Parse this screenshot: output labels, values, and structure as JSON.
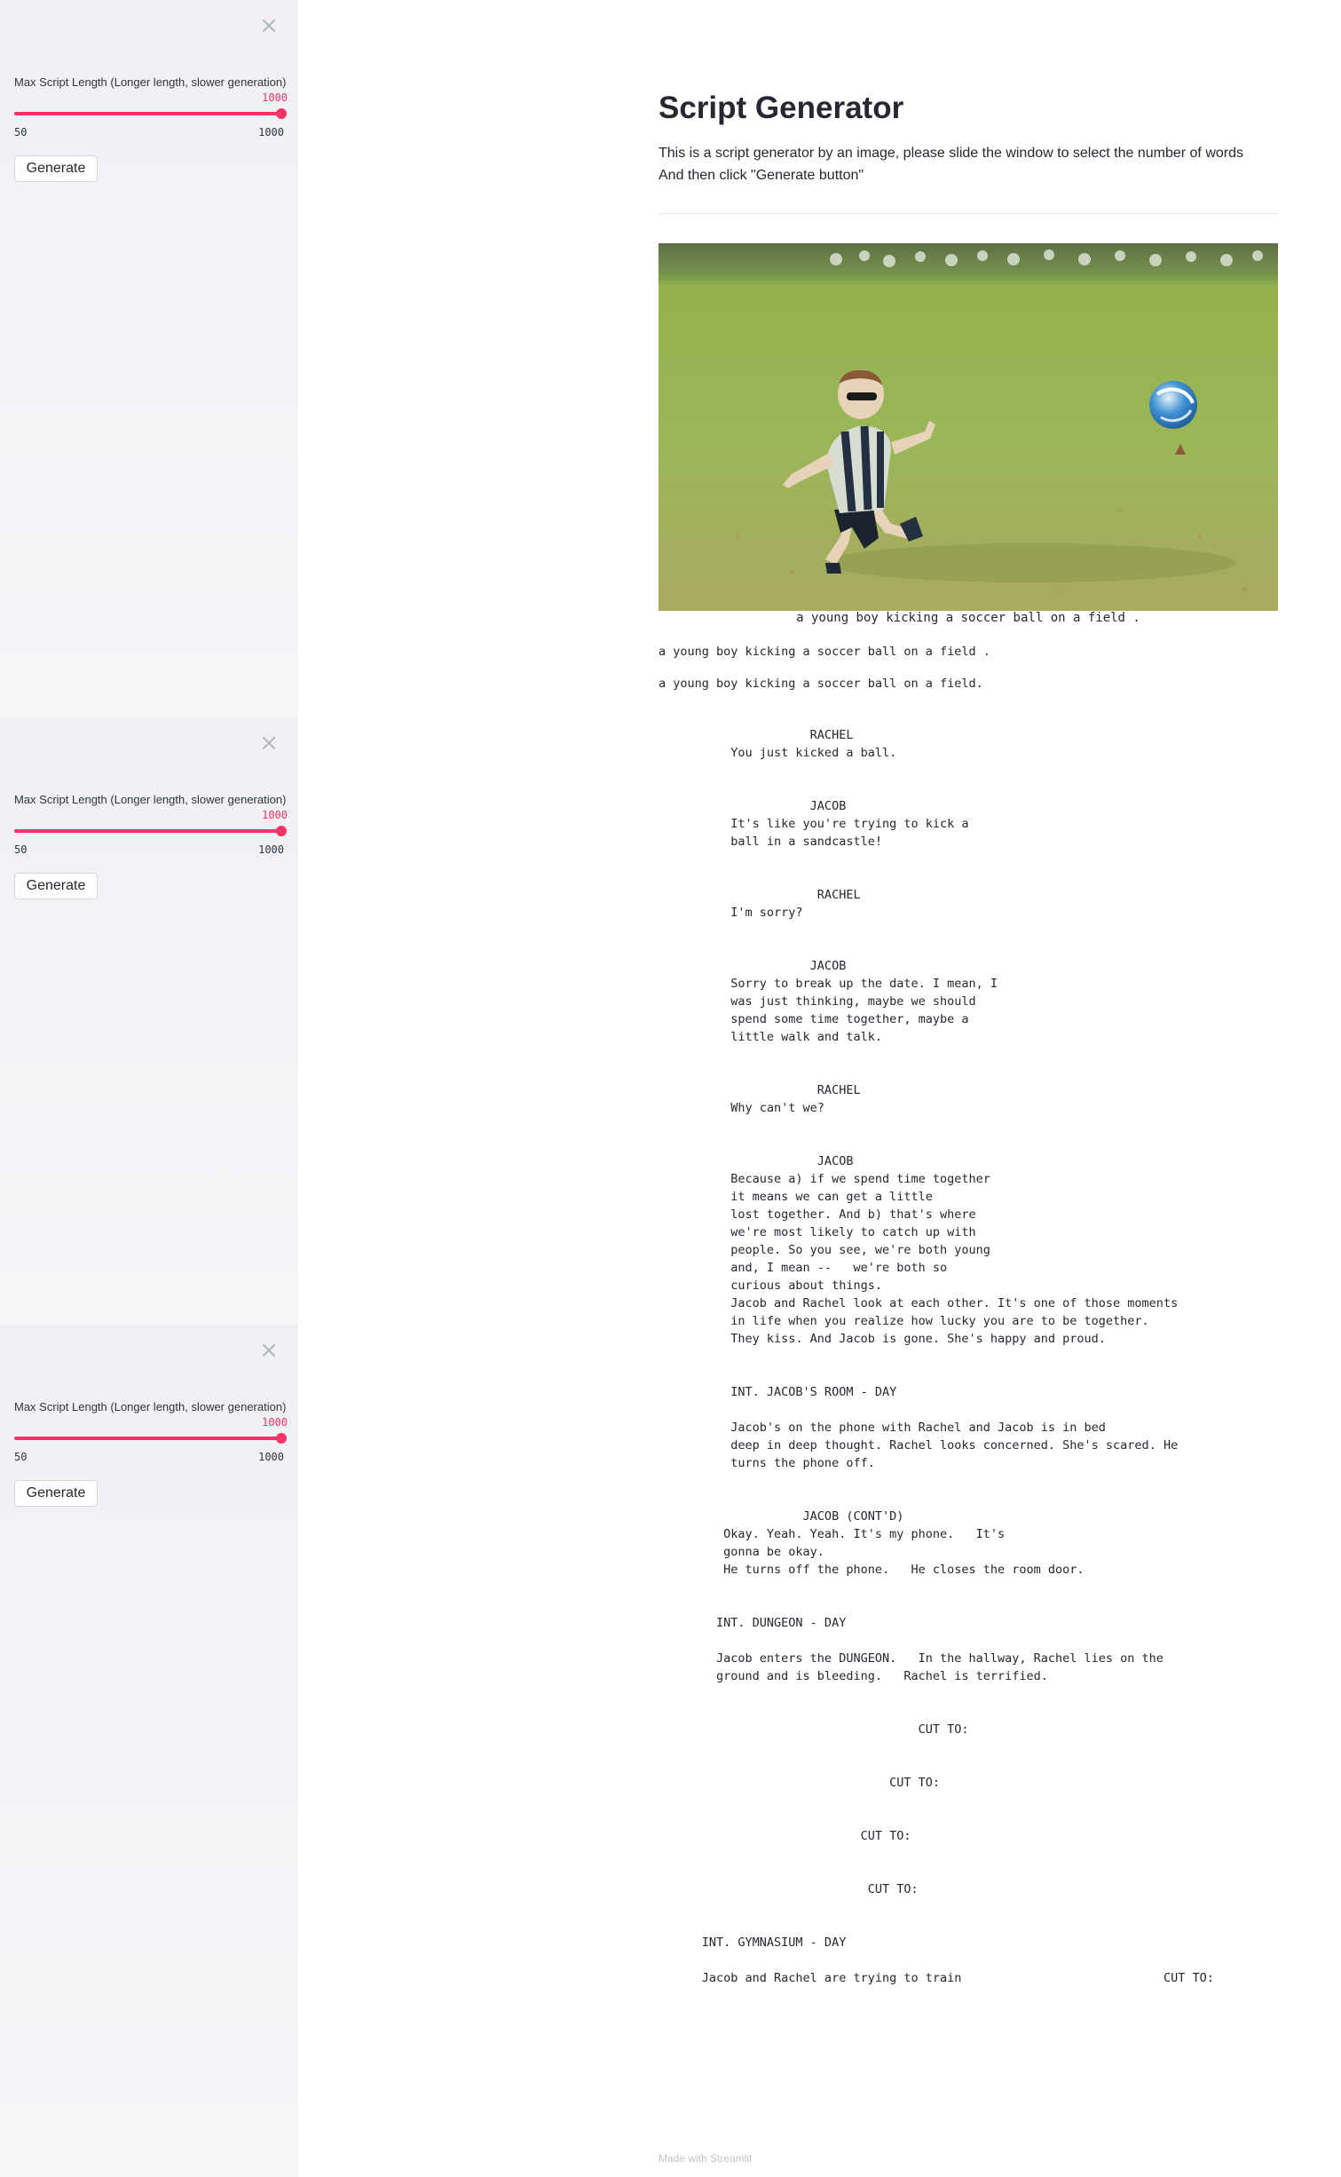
{
  "sidebar_panels": [
    {
      "close_icon": "close-icon",
      "slider_label": "Max Script Length (Longer length, slower generation)",
      "slider_value": "1000",
      "slider_min": "50",
      "slider_max": "1000",
      "slider_level": 1.0,
      "generate_label": "Generate"
    },
    {
      "close_icon": "close-icon",
      "slider_label": "Max Script Length (Longer length, slower generation)",
      "slider_value": "1000",
      "slider_min": "50",
      "slider_max": "1000",
      "slider_level": 1.0,
      "generate_label": "Generate"
    },
    {
      "close_icon": "close-icon",
      "slider_label": "Max Script Length (Longer length, slower generation)",
      "slider_value": "1000",
      "slider_min": "50",
      "slider_max": "1000",
      "slider_level": 1.0,
      "generate_label": "Generate"
    }
  ],
  "main": {
    "title": "Script Generator",
    "description_line1": "This is a script generator by an image, please slide the window to select the number of words",
    "description_line2": "And then click \"Generate button\"",
    "image_caption": "a young boy kicking a soccer ball on a field .",
    "caption_line1": "a young boy kicking a soccer ball on a field .",
    "caption_line2": "a young boy kicking a soccer ball on a field.",
    "script_text": "                     RACHEL\n          You just kicked a ball.\n\n\n                     JACOB\n          It's like you're trying to kick a\n          ball in a sandcastle!\n\n\n                      RACHEL\n          I'm sorry?\n\n\n                     JACOB\n          Sorry to break up the date. I mean, I\n          was just thinking, maybe we should\n          spend some time together, maybe a\n          little walk and talk.\n\n\n                      RACHEL\n          Why can't we?\n\n\n                      JACOB\n          Because a) if we spend time together\n          it means we can get a little\n          lost together. And b) that's where\n          we're most likely to catch up with\n          people. So you see, we're both young\n          and, I mean --   we're both so\n          curious about things.\n          Jacob and Rachel look at each other. It's one of those moments\n          in life when you realize how lucky you are to be together.\n          They kiss. And Jacob is gone. She's happy and proud.\n\n\n          INT. JACOB'S ROOM - DAY\n\n          Jacob's on the phone with Rachel and Jacob is in bed\n          deep in deep thought. Rachel looks concerned. She's scared. He\n          turns the phone off.\n\n\n                    JACOB (CONT'D)\n         Okay. Yeah. Yeah. It's my phone.   It's\n         gonna be okay.\n         He turns off the phone.   He closes the room door.\n\n\n        INT. DUNGEON - DAY\n\n        Jacob enters the DUNGEON.   In the hallway, Rachel lies on the\n        ground and is bleeding.   Rachel is terrified.\n\n\n                                    CUT TO:\n\n\n                                CUT TO:\n\n\n                            CUT TO:\n\n\n                             CUT TO:\n\n\n      INT. GYMNASIUM - DAY\n\n      Jacob and Rachel are trying to train                            CUT TO:"
  },
  "footer": {
    "text": "Made with Streamlit"
  },
  "colors": {
    "accent": "#f63366",
    "sidebar_bg": "#f0f2f6",
    "text": "#262730"
  }
}
